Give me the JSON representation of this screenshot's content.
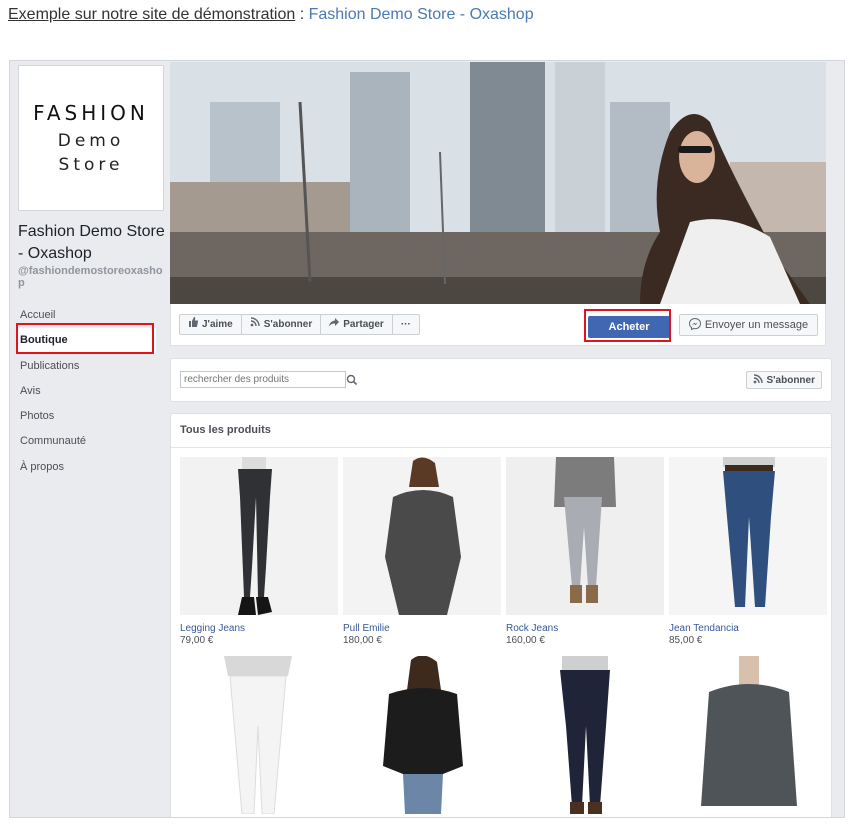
{
  "intro": {
    "text": "Exemple sur notre site de démonstration",
    "separator": " : ",
    "link": "Fashion Demo Store - Oxashop"
  },
  "logo": {
    "line1": "FASHION",
    "line2": "Demo",
    "line3": "Store"
  },
  "page": {
    "name": "Fashion Demo Store - Oxashop",
    "handle": "@fashiondemostoreoxashop"
  },
  "nav": {
    "items": [
      "Accueil",
      "Boutique",
      "Publications",
      "Avis",
      "Photos",
      "Communauté",
      "À propos"
    ],
    "active": "Boutique"
  },
  "actions": {
    "like": "J'aime",
    "follow": "S'abonner",
    "share": "Partager",
    "more": "···",
    "buy": "Acheter",
    "message": "Envoyer un message"
  },
  "search": {
    "placeholder": "rechercher des produits",
    "follow": "S'abonner"
  },
  "products": {
    "title": "Tous les produits",
    "items": [
      {
        "name": "Legging Jeans",
        "price": "79,00 €"
      },
      {
        "name": "Pull Emilie",
        "price": "180,00 €"
      },
      {
        "name": "Rock Jeans",
        "price": "160,00 €"
      },
      {
        "name": "Jean Tendancia",
        "price": "85,00 €"
      },
      {
        "name": "",
        "price": ""
      },
      {
        "name": "",
        "price": ""
      },
      {
        "name": "",
        "price": ""
      },
      {
        "name": "",
        "price": ""
      }
    ]
  },
  "colors": {
    "accent": "#4267b2",
    "highlight": "#e0141e",
    "link": "#365899",
    "background": "#e9ebee"
  }
}
